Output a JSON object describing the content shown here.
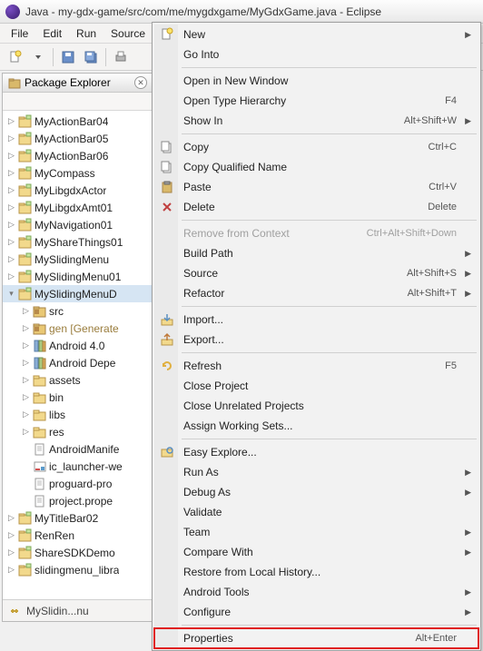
{
  "window": {
    "title": "Java - my-gdx-game/src/com/me/mygdxgame/MyGdxGame.java - Eclipse"
  },
  "menubar": [
    "File",
    "Edit",
    "Run",
    "Source"
  ],
  "explorer": {
    "title": "Package Explorer",
    "status": "MySlidin...nu"
  },
  "tree": [
    {
      "label": "MyActionBar04",
      "level": 1,
      "icon": "project",
      "tw": "▷"
    },
    {
      "label": "MyActionBar05",
      "level": 1,
      "icon": "project",
      "tw": "▷"
    },
    {
      "label": "MyActionBar06",
      "level": 1,
      "icon": "project",
      "tw": "▷"
    },
    {
      "label": "MyCompass",
      "level": 1,
      "icon": "project",
      "tw": "▷"
    },
    {
      "label": "MyLibgdxActor",
      "level": 1,
      "icon": "project",
      "tw": "▷"
    },
    {
      "label": "MyLibgdxAmt01",
      "level": 1,
      "icon": "project",
      "tw": "▷"
    },
    {
      "label": "MyNavigation01",
      "level": 1,
      "icon": "project",
      "tw": "▷"
    },
    {
      "label": "MyShareThings01",
      "level": 1,
      "icon": "project",
      "tw": "▷"
    },
    {
      "label": "MySlidingMenu",
      "level": 1,
      "icon": "project",
      "tw": "▷"
    },
    {
      "label": "MySlidingMenu01",
      "level": 1,
      "icon": "project",
      "tw": "▷"
    },
    {
      "label": "MySlidingMenuD",
      "level": 1,
      "icon": "project",
      "tw": "▾",
      "selected": true
    },
    {
      "label": "src",
      "level": 2,
      "icon": "srcfolder",
      "tw": "▷"
    },
    {
      "label": "gen [Generate",
      "level": 2,
      "icon": "srcfolder",
      "tw": "▷",
      "gen": true
    },
    {
      "label": "Android 4.0",
      "level": 2,
      "icon": "library",
      "tw": "▷"
    },
    {
      "label": "Android Depe",
      "level": 2,
      "icon": "library",
      "tw": "▷"
    },
    {
      "label": "assets",
      "level": 2,
      "icon": "folder",
      "tw": "▷"
    },
    {
      "label": "bin",
      "level": 2,
      "icon": "folder",
      "tw": "▷"
    },
    {
      "label": "libs",
      "level": 2,
      "icon": "folder",
      "tw": "▷"
    },
    {
      "label": "res",
      "level": 2,
      "icon": "folder",
      "tw": "▷"
    },
    {
      "label": "AndroidManife",
      "level": 2,
      "icon": "file",
      "tw": ""
    },
    {
      "label": "ic_launcher-we",
      "level": 2,
      "icon": "imgfile",
      "tw": ""
    },
    {
      "label": "proguard-pro",
      "level": 2,
      "icon": "file",
      "tw": ""
    },
    {
      "label": "project.prope",
      "level": 2,
      "icon": "file",
      "tw": ""
    },
    {
      "label": "MyTitleBar02",
      "level": 1,
      "icon": "project",
      "tw": "▷"
    },
    {
      "label": "RenRen",
      "level": 1,
      "icon": "project",
      "tw": "▷"
    },
    {
      "label": "ShareSDKDemo",
      "level": 1,
      "icon": "project",
      "tw": "▷"
    },
    {
      "label": "slidingmenu_libra",
      "level": 1,
      "icon": "project",
      "tw": "▷"
    }
  ],
  "context_menu": [
    {
      "type": "item",
      "label": "New",
      "submenu": true,
      "icon": "new"
    },
    {
      "type": "item",
      "label": "Go Into"
    },
    {
      "type": "sep"
    },
    {
      "type": "item",
      "label": "Open in New Window"
    },
    {
      "type": "item",
      "label": "Open Type Hierarchy",
      "shortcut": "F4"
    },
    {
      "type": "item",
      "label": "Show In",
      "shortcut": "Alt+Shift+W",
      "submenu": true
    },
    {
      "type": "sep"
    },
    {
      "type": "item",
      "label": "Copy",
      "shortcut": "Ctrl+C",
      "icon": "copy"
    },
    {
      "type": "item",
      "label": "Copy Qualified Name",
      "icon": "copy"
    },
    {
      "type": "item",
      "label": "Paste",
      "shortcut": "Ctrl+V",
      "icon": "paste"
    },
    {
      "type": "item",
      "label": "Delete",
      "shortcut": "Delete",
      "icon": "delete"
    },
    {
      "type": "sep"
    },
    {
      "type": "item",
      "label": "Remove from Context",
      "shortcut": "Ctrl+Alt+Shift+Down",
      "disabled": true
    },
    {
      "type": "item",
      "label": "Build Path",
      "submenu": true
    },
    {
      "type": "item",
      "label": "Source",
      "shortcut": "Alt+Shift+S",
      "submenu": true
    },
    {
      "type": "item",
      "label": "Refactor",
      "shortcut": "Alt+Shift+T",
      "submenu": true
    },
    {
      "type": "sep"
    },
    {
      "type": "item",
      "label": "Import...",
      "icon": "import"
    },
    {
      "type": "item",
      "label": "Export...",
      "icon": "export"
    },
    {
      "type": "sep"
    },
    {
      "type": "item",
      "label": "Refresh",
      "shortcut": "F5",
      "icon": "refresh"
    },
    {
      "type": "item",
      "label": "Close Project"
    },
    {
      "type": "item",
      "label": "Close Unrelated Projects"
    },
    {
      "type": "item",
      "label": "Assign Working Sets..."
    },
    {
      "type": "sep"
    },
    {
      "type": "item",
      "label": "Easy Explore...",
      "icon": "explore"
    },
    {
      "type": "item",
      "label": "Run As",
      "submenu": true
    },
    {
      "type": "item",
      "label": "Debug As",
      "submenu": true
    },
    {
      "type": "item",
      "label": "Validate"
    },
    {
      "type": "item",
      "label": "Team",
      "submenu": true
    },
    {
      "type": "item",
      "label": "Compare With",
      "submenu": true
    },
    {
      "type": "item",
      "label": "Restore from Local History..."
    },
    {
      "type": "item",
      "label": "Android Tools",
      "submenu": true
    },
    {
      "type": "item",
      "label": "Configure",
      "submenu": true
    },
    {
      "type": "sep"
    },
    {
      "type": "item",
      "label": "Properties",
      "shortcut": "Alt+Enter",
      "highlight": true
    }
  ]
}
